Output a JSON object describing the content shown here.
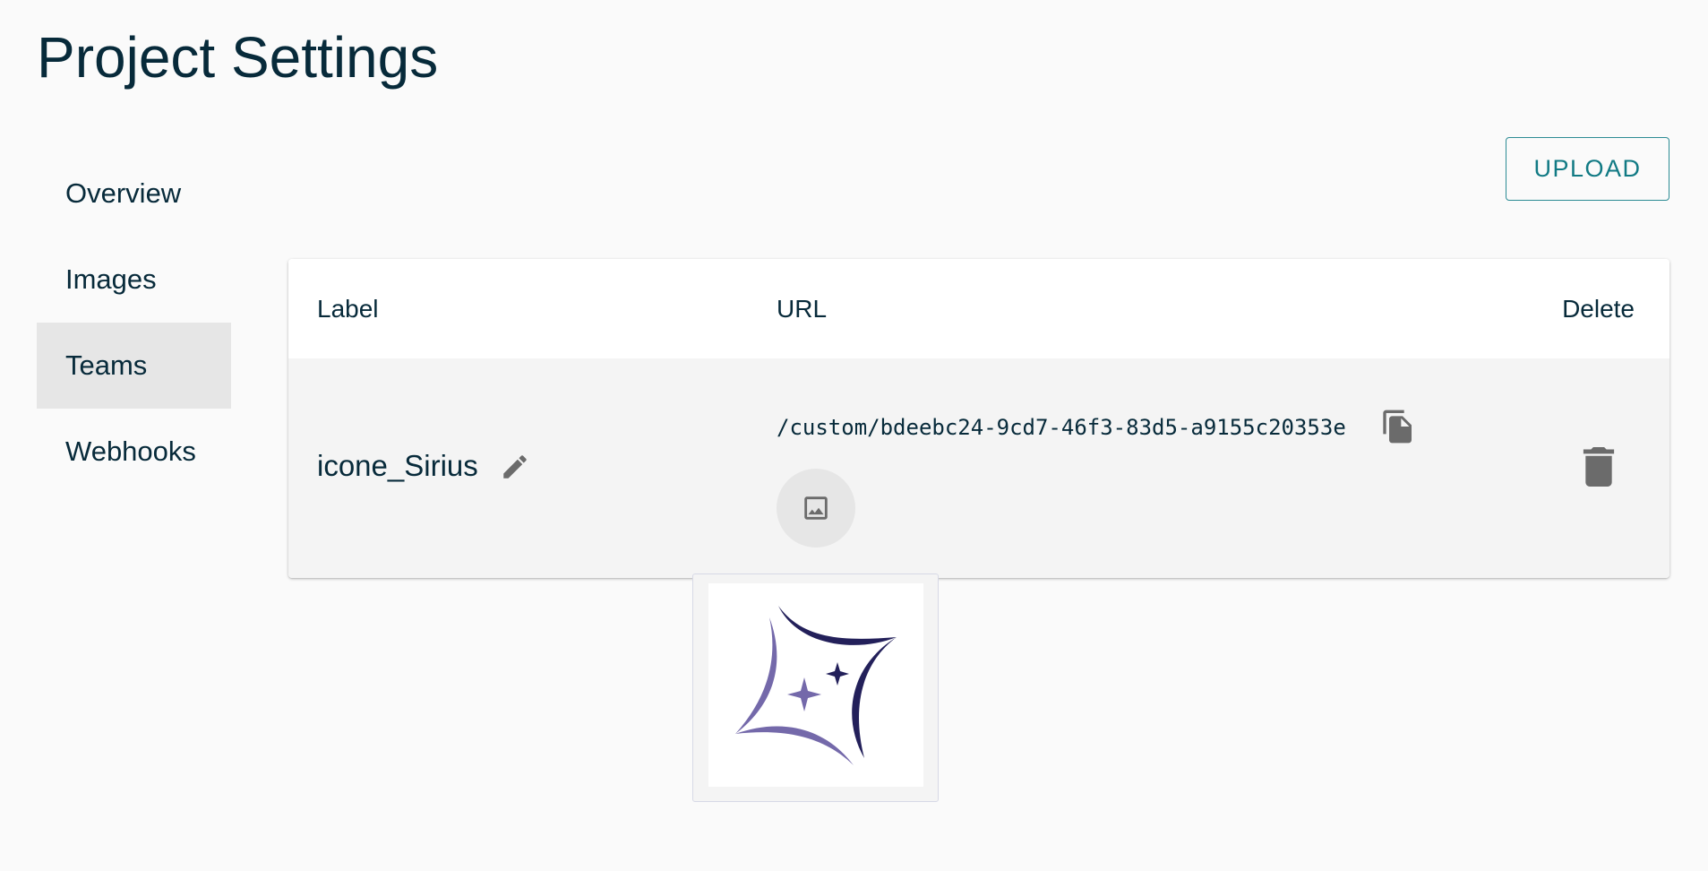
{
  "page": {
    "title": "Project Settings"
  },
  "sidebar": {
    "items": [
      {
        "label": "Overview",
        "active": false
      },
      {
        "label": "Images",
        "active": false
      },
      {
        "label": "Teams",
        "active": true
      },
      {
        "label": "Webhooks",
        "active": false
      }
    ]
  },
  "toolbar": {
    "upload_label": "UPLOAD"
  },
  "table": {
    "columns": [
      "Label",
      "URL",
      "Delete"
    ],
    "rows": [
      {
        "label": "icone_Sirius",
        "url": "/custom/bdeebc24-9cd7-46f3-83d5-a9155c20353e"
      }
    ]
  },
  "icons": {
    "edit": "pencil-icon",
    "copy": "copy-icon",
    "preview": "image-icon",
    "delete": "trash-icon"
  },
  "colors": {
    "text": "#072a3a",
    "accent": "#117a84",
    "icon": "#6b6b6b",
    "logo_dark": "#23205a",
    "logo_light": "#7469aa",
    "active_nav": "#e6e6e6",
    "row_bg": "#f4f4f4"
  }
}
